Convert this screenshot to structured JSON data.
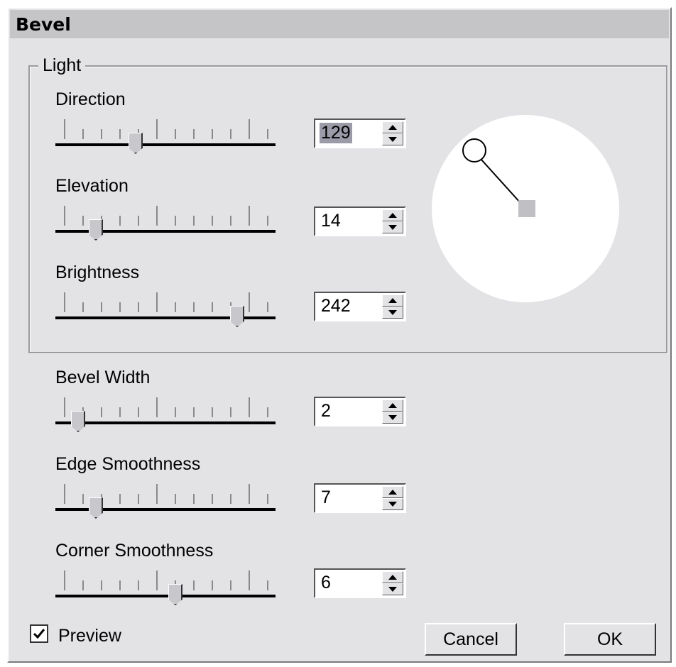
{
  "dialog": {
    "title": "Bevel"
  },
  "light": {
    "group_label": "Light",
    "direction": {
      "label": "Direction",
      "value": "129",
      "level": 0.36
    },
    "elevation": {
      "label": "Elevation",
      "value": "14",
      "level": 0.16
    },
    "brightness": {
      "label": "Brightness",
      "value": "242",
      "level": 0.87
    },
    "dial_icon": "light-direction-dial"
  },
  "bevel_width": {
    "label": "Bevel Width",
    "value": "2",
    "level": 0.07
  },
  "edge_smoothness": {
    "label": "Edge Smoothness",
    "value": "7",
    "level": 0.16
  },
  "corner_smoothness": {
    "label": "Corner Smoothness",
    "value": "6",
    "level": 0.56
  },
  "preview": {
    "label": "Preview",
    "checked": true
  },
  "buttons": {
    "cancel": "Cancel",
    "ok": "OK"
  }
}
